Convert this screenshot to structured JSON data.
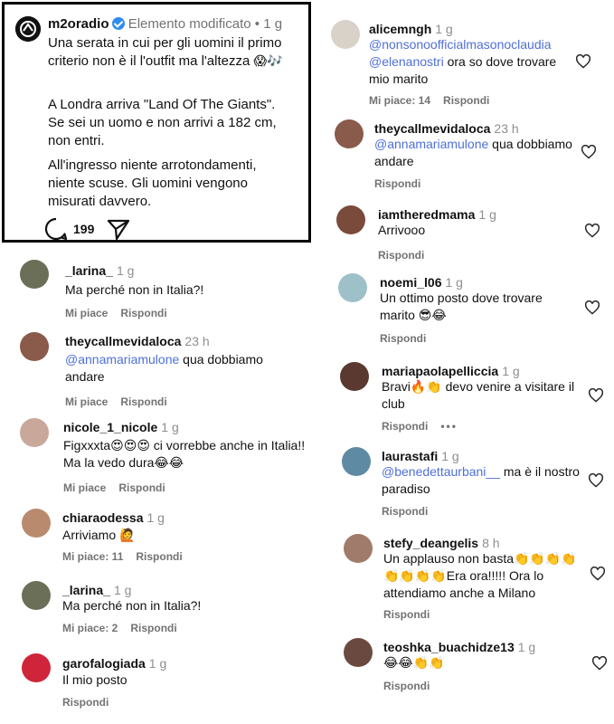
{
  "post": {
    "username": "m2oradio",
    "status": "Elemento modificato",
    "time": "1 g",
    "p1": "Una serata in cui per gli uomini il primo criterio non è il l'outfit ma l'altezza",
    "p1_emoji": "😱🎶",
    "p2": "A Londra arriva \"Land Of The Giants\". Se sei un uomo e non arrivi a 182 cm, non entri.",
    "p3": "All'ingresso niente arrotondamenti, niente scuse. Gli uomini vengono misurati davvero.",
    "comment_count": "199"
  },
  "left_comments": [
    {
      "user": "_larina_",
      "time": "1 g",
      "text": "Ma perché non in Italia?!",
      "meta": [
        "Mi piace",
        "Rispondi"
      ],
      "avatar": "#6b6f58"
    },
    {
      "user": "theycallmevidaloca",
      "time": "23 h",
      "mention": "@annamariamulone",
      "text": " qua dobbiamo andare",
      "meta": [
        "Mi piace",
        "Rispondi"
      ],
      "avatar": "#8a5a4a"
    },
    {
      "user": "nicole_1_nicole",
      "time": "1 g",
      "text": "Figxxxta😍😍😍 ci vorrebbe anche in Italia!! Ma la vedo dura😂😂",
      "meta": [
        "Mi piace",
        "Rispondi"
      ],
      "avatar": "#c9a79a"
    },
    {
      "user": "chiaraodessa",
      "time": "1 g",
      "text": "Arriviamo 🙋",
      "meta": [
        "Mi piace: 11",
        "Rispondi"
      ],
      "avatar": "#b98a6e"
    },
    {
      "user": "_larina_",
      "time": "1 g",
      "text": "Ma perché non in Italia?!",
      "meta": [
        "Mi piace: 2",
        "Rispondi"
      ],
      "avatar": "#6b6f58"
    },
    {
      "user": "garofalogiada",
      "time": "1 g",
      "text": "Il mio posto",
      "meta": [
        "Rispondi"
      ],
      "avatar": "#d0243a"
    }
  ],
  "right_comments": [
    {
      "user": "alicemngh",
      "time": "1 g",
      "mention": "@nonsonoofficialmasonoclaudia @elenanostri",
      "text": " ora so dove trovare mio marito",
      "meta": [
        "Mi piace: 14",
        "Rispondi"
      ],
      "avatar": "#d8d2c8"
    },
    {
      "user": "theycallmevidaloca",
      "time": "23 h",
      "mention": "@annamariamulone",
      "text": " qua dobbiamo andare",
      "meta": [
        "Rispondi"
      ],
      "avatar": "#8a5a4a"
    },
    {
      "user": "iamtheredmama",
      "time": "1 g",
      "text": "Arrivooo",
      "meta": [
        "Rispondi"
      ],
      "avatar": "#7a4a3a"
    },
    {
      "user": "noemi_l06",
      "time": "1 g",
      "text": "Un ottimo posto dove trovare marito 😎😂",
      "meta": [
        "Rispondi"
      ],
      "avatar": "#9ec0c8"
    },
    {
      "user": "mariapaolapelliccia",
      "time": "1 g",
      "text": "Bravi🔥👏 devo venire a visitare il club",
      "meta": [
        "Rispondi",
        "•••"
      ],
      "avatar": "#5a3a30"
    },
    {
      "user": "laurastafi",
      "time": "1 g",
      "mention": "@benedettaurbani__",
      "text": " ma è il nostro paradiso",
      "meta": [
        "Rispondi"
      ],
      "avatar": "#5f8aa3"
    },
    {
      "user": "stefy_deangelis",
      "time": "8 h",
      "text": "Un applauso non basta👏👏👏👏👏👏👏👏Era ora!!!!! Ora lo attendiamo anche a Milano",
      "meta": [
        "Rispondi"
      ],
      "avatar": "#a07a6a"
    },
    {
      "user": "teoshka_buachidze13",
      "time": "1 g",
      "text": "😂😂👏👏",
      "meta": [
        "Rispondi"
      ],
      "avatar": "#6a4a40"
    }
  ]
}
